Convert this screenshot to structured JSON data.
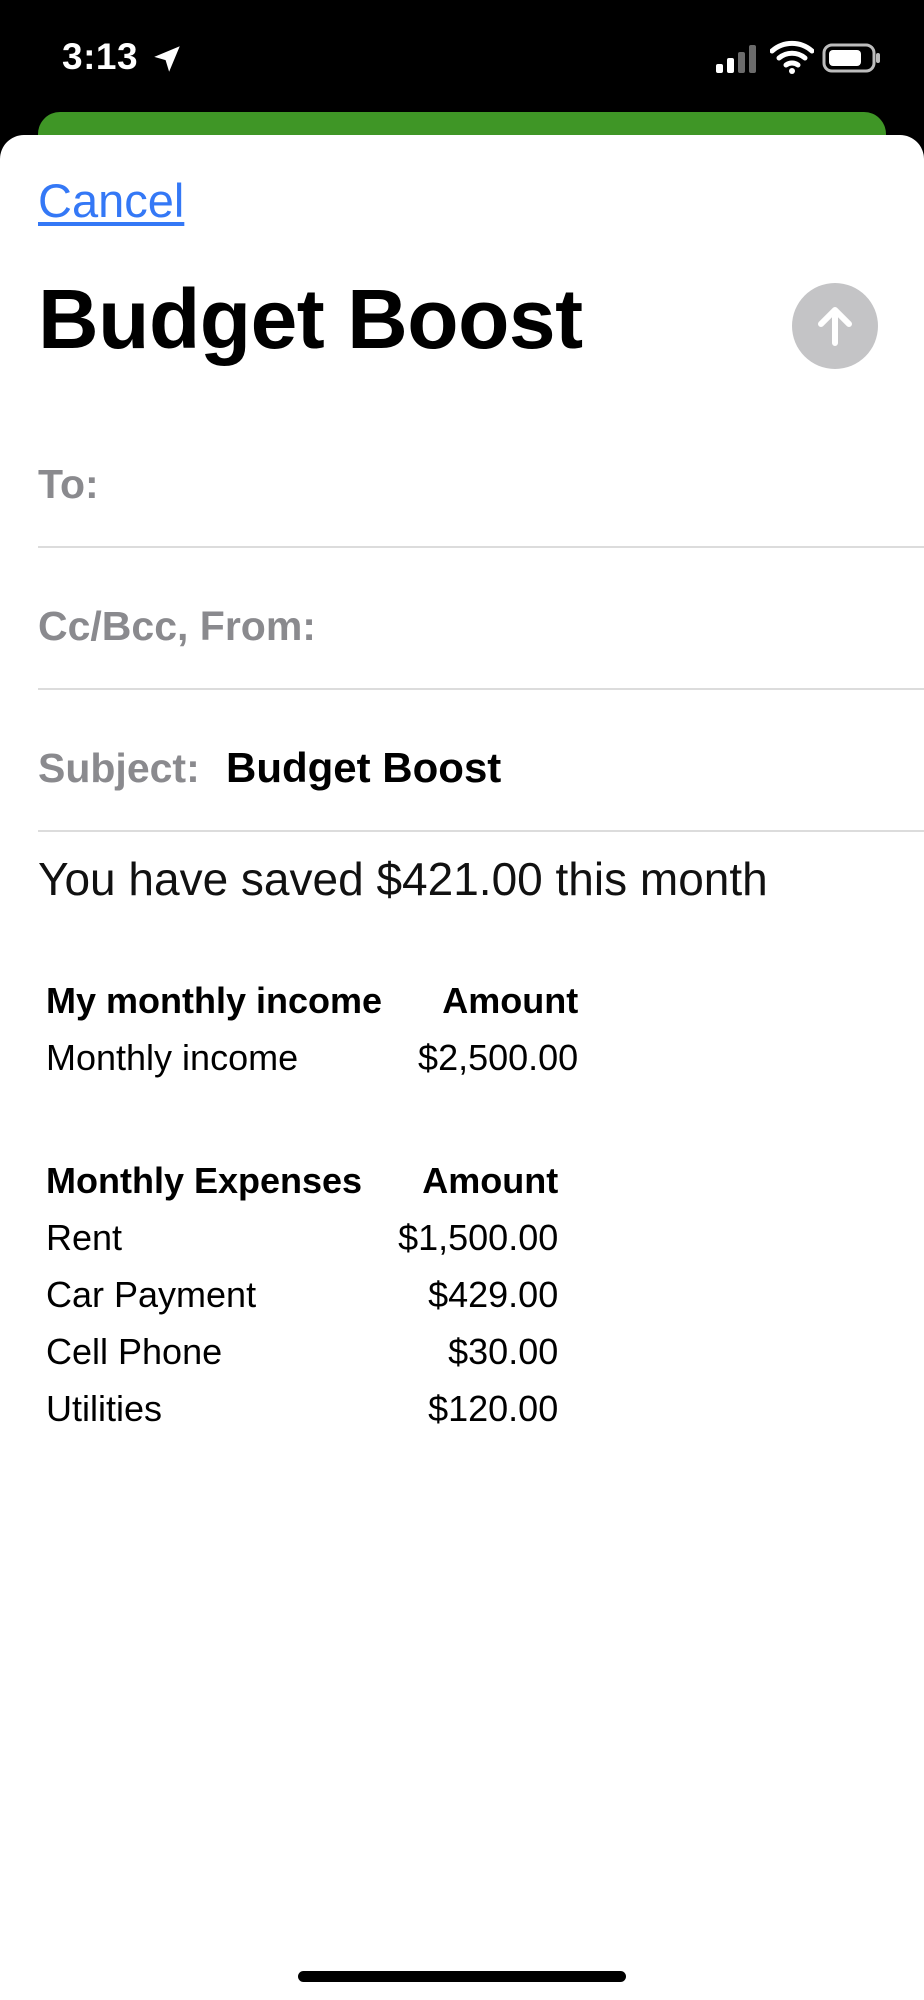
{
  "status_bar": {
    "time": "3:13",
    "accent": "#ffffff"
  },
  "compose": {
    "cancel_label": "Cancel",
    "title": "Budget Boost",
    "to_label": "To:",
    "cc_from_label": "Cc/Bcc, From:",
    "subject_label": "Subject:",
    "subject_value": "Budget Boost"
  },
  "message": {
    "summary": "You have saved $421.00 this month",
    "income": {
      "headers": [
        "My monthly income",
        "Amount"
      ],
      "rows": [
        [
          "Monthly income",
          "$2,500.00"
        ]
      ]
    },
    "expenses": {
      "headers": [
        "Monthly Expenses",
        "Amount"
      ],
      "rows": [
        [
          "Rent",
          "$1,500.00"
        ],
        [
          "Car Payment",
          "$429.00"
        ],
        [
          "Cell Phone",
          "$30.00"
        ],
        [
          "Utilities",
          "$120.00"
        ]
      ]
    }
  },
  "colors": {
    "link_blue": "#3478f6",
    "background_card_green": "#3f9626",
    "send_button_gray": "#c4c4c6",
    "label_gray": "#8a8a8e"
  },
  "icons": [
    "location-arrow-icon",
    "cellular-signal-icon",
    "wifi-icon",
    "battery-icon",
    "arrow-up-icon"
  ]
}
